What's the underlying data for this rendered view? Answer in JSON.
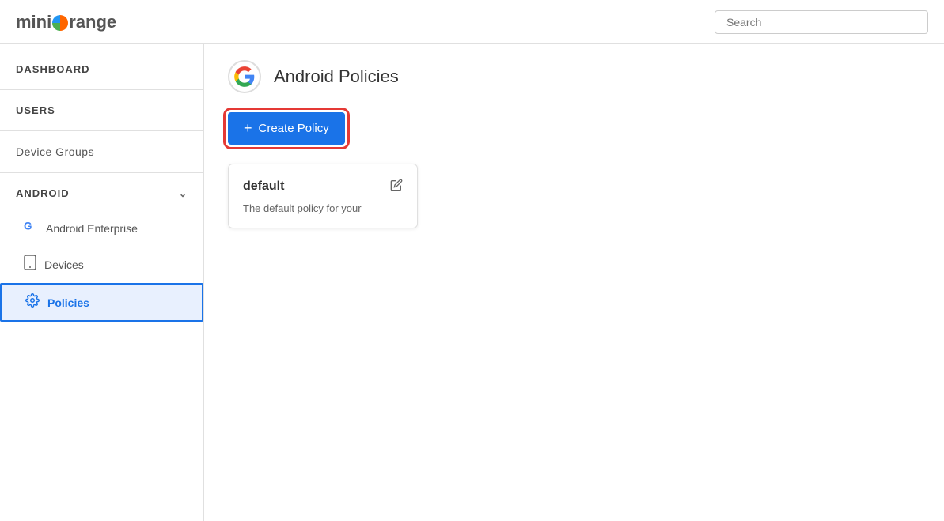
{
  "header": {
    "logo": {
      "mini": "mini",
      "range": "range"
    },
    "search_placeholder": "Search"
  },
  "sidebar": {
    "dashboard_label": "DASHBOARD",
    "users_label": "USERS",
    "device_groups_label": "Device Groups",
    "android_label": "ANDROID",
    "sub_items": [
      {
        "label": "Android Enterprise",
        "icon": "G"
      },
      {
        "label": "Devices",
        "icon": "📱"
      },
      {
        "label": "Policies",
        "icon": "⚙"
      }
    ]
  },
  "main": {
    "page_title": "Android Policies",
    "create_button_label": "+ Create Policy",
    "policy_card": {
      "name": "default",
      "description": "The default policy for your"
    }
  }
}
